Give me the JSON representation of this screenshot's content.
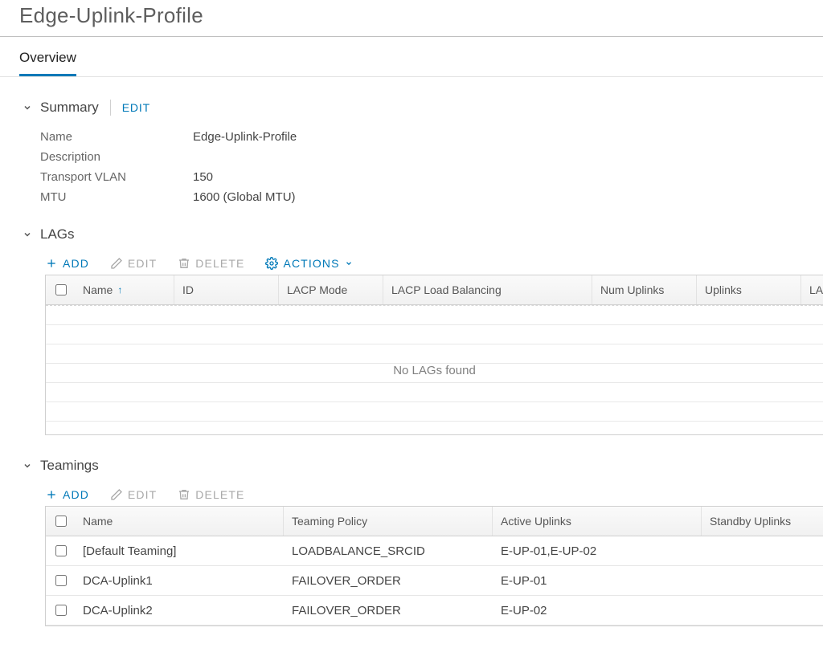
{
  "page_title": "Edge-Uplink-Profile",
  "tabs": {
    "overview": "Overview"
  },
  "summary": {
    "heading": "Summary",
    "edit_label": "EDIT",
    "rows": {
      "name": {
        "label": "Name",
        "value": "Edge-Uplink-Profile"
      },
      "description": {
        "label": "Description",
        "value": ""
      },
      "tvlan": {
        "label": "Transport VLAN",
        "value": "150"
      },
      "mtu": {
        "label": "MTU",
        "value": "1600 (Global MTU)"
      }
    }
  },
  "lags": {
    "heading": "LAGs",
    "toolbar": {
      "add": "ADD",
      "edit": "EDIT",
      "delete": "DELETE",
      "actions": "ACTIONS"
    },
    "columns": {
      "name": "Name",
      "id": "ID",
      "lacp_mode": "LACP Mode",
      "lacp_lb": "LACP Load Balancing",
      "num_uplinks": "Num Uplinks",
      "uplinks": "Uplinks",
      "last": "LA"
    },
    "empty_text": "No LAGs found"
  },
  "teamings": {
    "heading": "Teamings",
    "toolbar": {
      "add": "ADD",
      "edit": "EDIT",
      "delete": "DELETE"
    },
    "columns": {
      "name": "Name",
      "policy": "Teaming Policy",
      "active": "Active Uplinks",
      "standby": "Standby Uplinks"
    },
    "rows": [
      {
        "name": "[Default Teaming]",
        "policy": "LOADBALANCE_SRCID",
        "active": "E-UP-01,E-UP-02",
        "standby": ""
      },
      {
        "name": "DCA-Uplink1",
        "policy": "FAILOVER_ORDER",
        "active": "E-UP-01",
        "standby": ""
      },
      {
        "name": "DCA-Uplink2",
        "policy": "FAILOVER_ORDER",
        "active": "E-UP-02",
        "standby": ""
      }
    ]
  }
}
